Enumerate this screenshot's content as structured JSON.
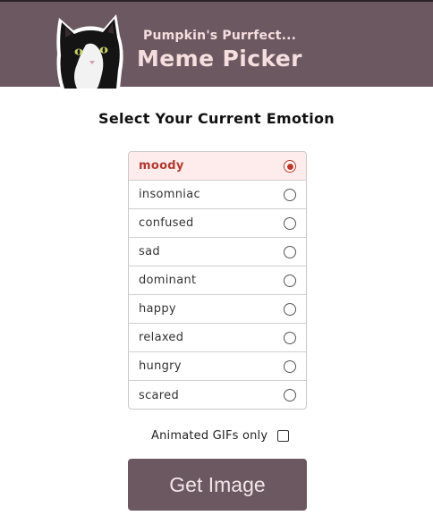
{
  "header": {
    "subtitle": "Pumpkin's Purrfect...",
    "title": "Meme Picker"
  },
  "heading": "Select Your Current Emotion",
  "emotions": {
    "items": [
      {
        "label": "moody",
        "selected": true
      },
      {
        "label": "insomniac",
        "selected": false
      },
      {
        "label": "confused",
        "selected": false
      },
      {
        "label": "sad",
        "selected": false
      },
      {
        "label": "dominant",
        "selected": false
      },
      {
        "label": "happy",
        "selected": false
      },
      {
        "label": "relaxed",
        "selected": false
      },
      {
        "label": "hungry",
        "selected": false
      },
      {
        "label": "scared",
        "selected": false
      }
    ]
  },
  "gif_option": {
    "label": "Animated GIFs only",
    "checked": false
  },
  "button": {
    "label": "Get Image"
  },
  "colors": {
    "brand": "#6b5860",
    "brand_text": "#f6dede",
    "selected_bg": "#fdeceb",
    "selected_text": "#b23a30"
  }
}
